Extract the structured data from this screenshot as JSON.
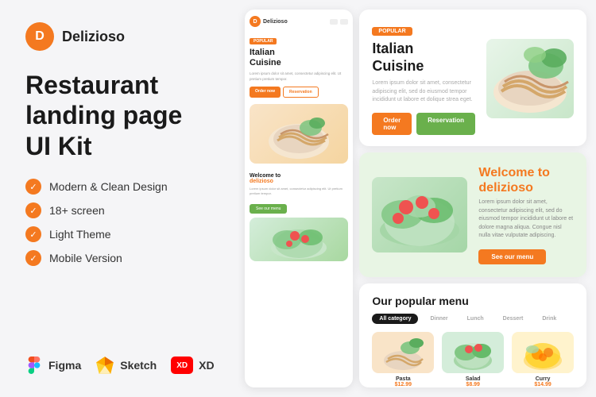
{
  "logo": {
    "letter": "D",
    "name": "Delizioso"
  },
  "title": {
    "line1": "Restaurant",
    "line2": "landing page",
    "line3": "UI Kit"
  },
  "features": [
    {
      "text": "Modern & Clean Design"
    },
    {
      "text": "18+ screen"
    },
    {
      "text": "Light Theme"
    },
    {
      "text": "Mobile Version"
    }
  ],
  "tools": [
    {
      "name": "Figma",
      "icon": "figma-icon"
    },
    {
      "name": "Sketch",
      "icon": "sketch-icon"
    },
    {
      "name": "XD",
      "icon": "xd-icon"
    }
  ],
  "mobile": {
    "tag": "POPULAR",
    "heading": "Italian\nCuisine",
    "desc": "Lorem ipsum dolor sit amet, consectetur adipiscing elit. Ut pretium pretium tempor.",
    "btn1": "Order now",
    "btn2": "Reservation",
    "section2_title": "Welcome to",
    "section2_subtitle": "delizioso",
    "section2_desc": "Lorem ipsum dolor sit amet, consectetur adipiscing elit. Ut pretium pretium tempor.",
    "section2_btn": "See our menu"
  },
  "desktop_top": {
    "tag": "POPULAR",
    "heading1": "Italian",
    "heading2": "Cuisine",
    "desc": "Lorem ipsum dolor sit amet, consectetur adipiscing elit, sed do eiusmod tempor incididunt ut labore et dolique strea eget.",
    "btn1": "Order now",
    "btn2": "Reservation"
  },
  "desktop_mid": {
    "heading1": "Welcome to",
    "heading2": "delizioso",
    "desc": "Lorem ipsum dolor sit amet, consectetur adipiscing elit, sed do eiusmod tempor incididunt ut labore et dolore magna aliqua. Congue nisl nulla vitae vulputate adipiscing.",
    "btn": "See our menu"
  },
  "desktop_bot": {
    "title": "Our popular menu",
    "tabs": [
      "All category",
      "Dinner",
      "Lunch",
      "Dessert",
      "Drink"
    ],
    "active_tab": "All category",
    "items": [
      {
        "name": "Pasta",
        "price": "$12.99",
        "bg": "#f9e4c8"
      },
      {
        "name": "Salad",
        "price": "$8.99",
        "bg": "#d4edda"
      },
      {
        "name": "Curry",
        "price": "$14.99",
        "bg": "#fff3cd"
      }
    ]
  },
  "colors": {
    "orange": "#f47920",
    "green": "#6ab04c",
    "light_green_bg": "#e8f5e4"
  }
}
